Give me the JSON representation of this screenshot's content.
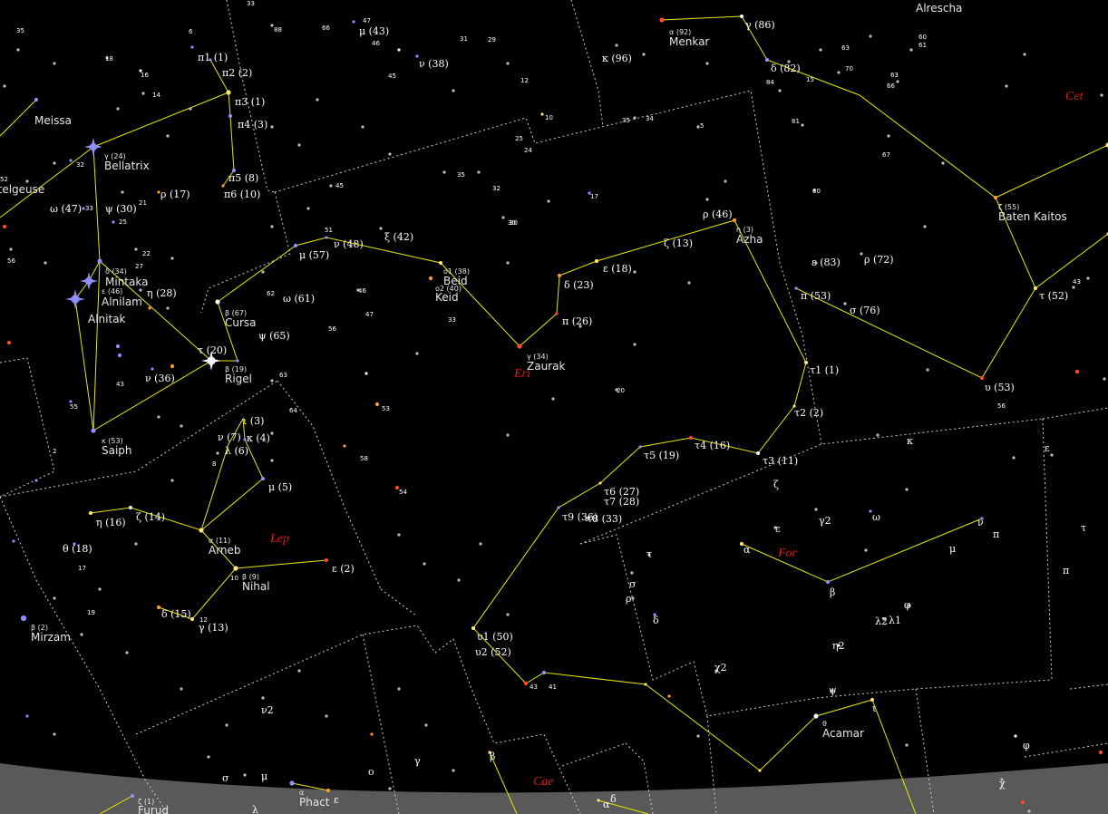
{
  "view": {
    "background": "#000000",
    "horizon_color": "#555555",
    "figure_line_color": "#e8e800",
    "boundary_line_color": "#d8d8d8"
  },
  "constellations": [
    {
      "name": "Cet"
    },
    {
      "name": "Eri"
    },
    {
      "name": "Lep"
    },
    {
      "name": "For"
    },
    {
      "name": "Cae"
    }
  ],
  "named_stars": [
    {
      "name": "Alrescha"
    },
    {
      "name": "Menkar",
      "desig": "α (92)"
    },
    {
      "name": "Bellatrix",
      "desig": "γ (24)"
    },
    {
      "name": "Betelgeuse"
    },
    {
      "name": "Meissa"
    },
    {
      "name": "Mintaka",
      "desig": "δ (34)"
    },
    {
      "name": "Alnilam",
      "desig": "ε (46)"
    },
    {
      "name": "Alnitak"
    },
    {
      "name": "Saiph",
      "desig": "κ (53)"
    },
    {
      "name": "Rigel",
      "desig": "β (19)"
    },
    {
      "name": "Cursa",
      "desig": "β (67)"
    },
    {
      "name": "Beid",
      "desig": "o1 (38)"
    },
    {
      "name": "Keid",
      "desig": "o2 (40)"
    },
    {
      "name": "Zaurak",
      "desig": "γ (34)"
    },
    {
      "name": "Azha",
      "desig": "η (3)"
    },
    {
      "name": "Baten Kaitos",
      "desig": "ζ (55)"
    },
    {
      "name": "Arneb",
      "desig": "α (11)"
    },
    {
      "name": "Nihal",
      "desig": "β (9)"
    },
    {
      "name": "Mirzam",
      "desig": "β (2)"
    },
    {
      "name": "Acamar",
      "desig": "θ"
    },
    {
      "name": "Phact",
      "desig": "α"
    },
    {
      "name": "Furud",
      "desig": "ζ (1)"
    }
  ],
  "greek_labels": [
    "γ (86)",
    "δ (82)",
    "μ (43)",
    "ν (38)",
    "κ (96)",
    "π1 (1)",
    "π2 (2)",
    "π3 (1)",
    "π4 (3)",
    "π5 (8)",
    "π6 (10)",
    "ω (47)",
    "ψ (30)",
    "ρ (17)",
    "η (28)",
    "ν (36)",
    "τ (20)",
    "μ (57)",
    "ν (48)",
    "ξ (42)",
    "ω (61)",
    "ψ (65)",
    "δ (23)",
    "ε (18)",
    "ζ (13)",
    "π (26)",
    "ρ (46)",
    "ε (83)",
    "ρ (72)",
    "π (53)",
    "σ (76)",
    "τ (52)",
    "υ (53)",
    "τ1 (1)",
    "τ2 (2)",
    "τ3 (11)",
    "τ4 (16)",
    "τ5 (19)",
    "τ6 (27)",
    "τ7 (28)",
    "τ8 (33)",
    "τ9 (36)",
    "υ1 (50)",
    "υ2 (52)",
    "ι (3)",
    "κ (4)",
    "λ (6)",
    "ν (7)",
    "μ (5)",
    "η (16)",
    "ζ (14)",
    "θ (18)",
    "ε (2)",
    "δ (15)",
    "γ (13)",
    "κ",
    "ζ",
    "ε",
    "γ2",
    "ω",
    "ν",
    "π",
    "μ",
    "α",
    "β",
    "φ",
    "λ2",
    "λ1",
    "η2",
    "τ",
    "σ",
    "ρ",
    "δ",
    "χ2",
    "ψ",
    "ι",
    "φ",
    "χ",
    "ε",
    "π",
    "τ",
    "ν2",
    "σ",
    "μ",
    "ο",
    "γ",
    "β",
    "λ",
    "ε",
    "α",
    "δ"
  ],
  "flamsteed_labels": [
    "35",
    "6",
    "33",
    "88",
    "66",
    "47",
    "46",
    "31",
    "29",
    "45",
    "12",
    "60",
    "61",
    "63",
    "70",
    "84",
    "15",
    "63",
    "66",
    "18",
    "16",
    "14",
    "10",
    "35",
    "34",
    "5",
    "81",
    "25",
    "24",
    "67",
    "52",
    "32",
    "35",
    "32",
    "45",
    "22",
    "21",
    "33",
    "25",
    "30",
    "17",
    "80",
    "51",
    "56",
    "27",
    "62",
    "46",
    "47",
    "56",
    "33",
    "55",
    "43",
    "63",
    "64",
    "53",
    "20",
    "58",
    "54",
    "2",
    "8",
    "17",
    "19",
    "10",
    "12",
    "9",
    "41",
    "43",
    "56",
    "43",
    "30"
  ]
}
